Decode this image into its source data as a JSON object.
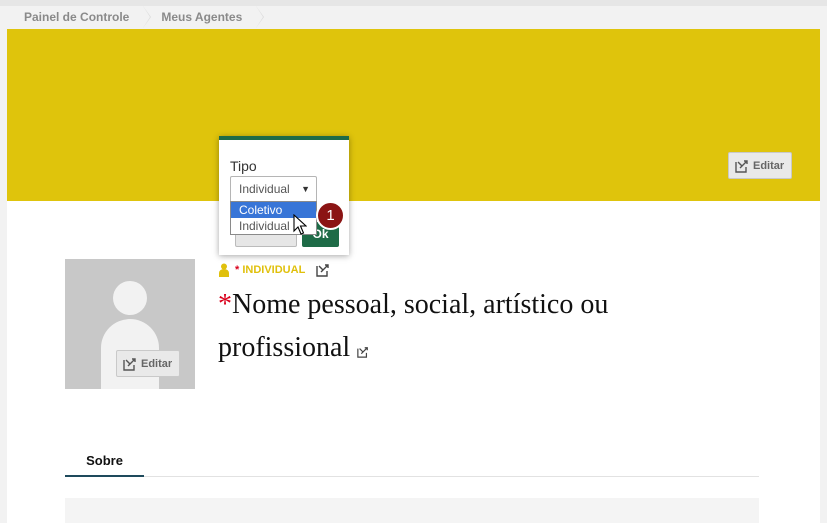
{
  "breadcrumb": {
    "items": [
      "Painel de Controle",
      "Meus Agentes"
    ]
  },
  "colors": {
    "cover": "#dfc40c",
    "accent_green": "#1e6b47",
    "required": "#d9001b",
    "type_label": "#e0c00c",
    "step_badge": "#8b1414",
    "dropdown_highlight": "#3875d7"
  },
  "cover": {
    "edit_label": "Editar"
  },
  "type_popover": {
    "label": "Tipo",
    "selected_value": "Individual",
    "options": [
      "Coletivo",
      "Individual"
    ],
    "highlighted_option": "Coletivo",
    "ok_label": "Ok"
  },
  "step_marker": "1",
  "avatar": {
    "edit_label": "Editar"
  },
  "agent": {
    "required_mark": "*",
    "type": "INDIVIDUAL",
    "name_placeholder": "Nome pessoal, social, artístico ou profissional"
  },
  "tabs": [
    "Sobre"
  ],
  "icons": {
    "edit": "pencil-square-icon",
    "person": "person-icon",
    "cursor": "mouse-pointer-icon"
  }
}
